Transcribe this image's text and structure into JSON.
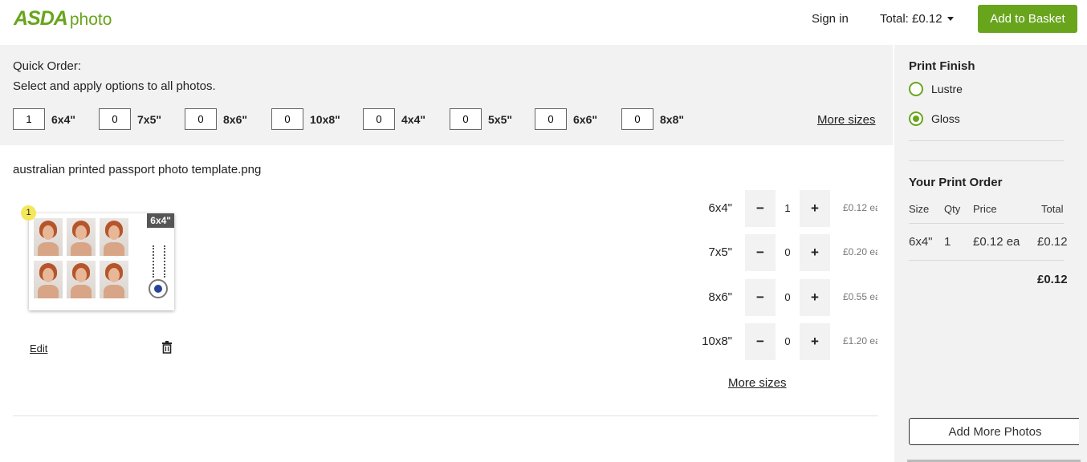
{
  "header": {
    "logo_asda": "ASDA",
    "logo_photo": "photo",
    "sign_in": "Sign in",
    "total": "Total: £0.12",
    "add_to_basket": "Add to Basket"
  },
  "quick_order": {
    "title": "Quick Order:",
    "subtitle": "Select and apply options to all photos.",
    "items": [
      {
        "qty": "1",
        "size": "6x4\""
      },
      {
        "qty": "0",
        "size": "7x5\""
      },
      {
        "qty": "0",
        "size": "8x6\""
      },
      {
        "qty": "0",
        "size": "10x8\""
      },
      {
        "qty": "0",
        "size": "4x4\""
      },
      {
        "qty": "0",
        "size": "5x5\""
      },
      {
        "qty": "0",
        "size": "6x6\""
      },
      {
        "qty": "0",
        "size": "8x8\""
      }
    ],
    "more_sizes": "More sizes"
  },
  "photo": {
    "filename": "australian printed passport photo template.png",
    "badge_number": "1",
    "size_tag": "6x4\"",
    "edit": "Edit",
    "sizes": [
      {
        "label": "6x4\"",
        "qty": "1",
        "price": "£0.12 ea"
      },
      {
        "label": "7x5\"",
        "qty": "0",
        "price": "£0.20 ea"
      },
      {
        "label": "8x6\"",
        "qty": "0",
        "price": "£0.55 ea"
      },
      {
        "label": "10x8\"",
        "qty": "0",
        "price": "£1.20 ea"
      }
    ],
    "minus": "−",
    "plus": "+",
    "more_sizes": "More sizes"
  },
  "sidebar": {
    "print_finish_title": "Print Finish",
    "finish_options": [
      {
        "label": "Lustre",
        "selected": false
      },
      {
        "label": "Gloss",
        "selected": true
      }
    ],
    "order_title": "Your Print Order",
    "columns": [
      "Size",
      "Qty",
      "Price",
      "Total"
    ],
    "rows": [
      {
        "size": "6x4\"",
        "qty": "1",
        "price": "£0.12 ea",
        "total": "£0.12"
      }
    ],
    "grand_total": "£0.12",
    "add_more": "Add More Photos"
  },
  "colors": {
    "brand_green": "#68a51d",
    "panel_grey": "#f2f2f2"
  }
}
